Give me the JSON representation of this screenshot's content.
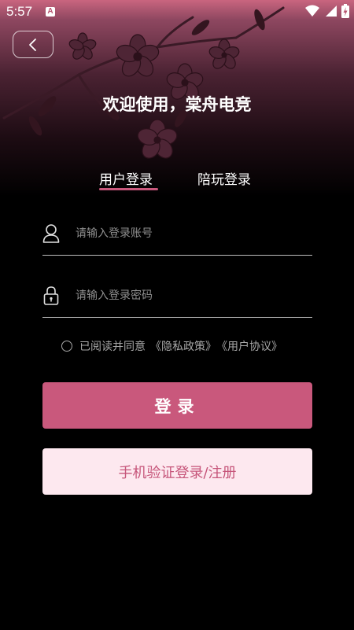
{
  "status_bar": {
    "time": "5:57",
    "notification_badge": "A",
    "icons": [
      "wifi-icon",
      "signal-icon",
      "battery-icon"
    ]
  },
  "header": {
    "welcome_title": "欢迎使用，棠舟电竞"
  },
  "tabs": [
    {
      "label": "用户登录",
      "active": true
    },
    {
      "label": "陪玩登录",
      "active": false
    }
  ],
  "form": {
    "account_placeholder": "请输入登录账号",
    "account_value": "",
    "password_placeholder": "请输入登录密码",
    "password_value": ""
  },
  "agreement": {
    "checked": false,
    "prefix": "已阅读并同意",
    "privacy_link": "《隐私政策》",
    "user_agreement_link": "《用户协议》"
  },
  "buttons": {
    "login": "登录",
    "sms_login": "手机验证登录/注册"
  },
  "colors": {
    "accent": "#c9587c",
    "secondary_button_bg": "#fde8ef",
    "secondary_button_text": "#c6557a",
    "background": "#000000"
  }
}
